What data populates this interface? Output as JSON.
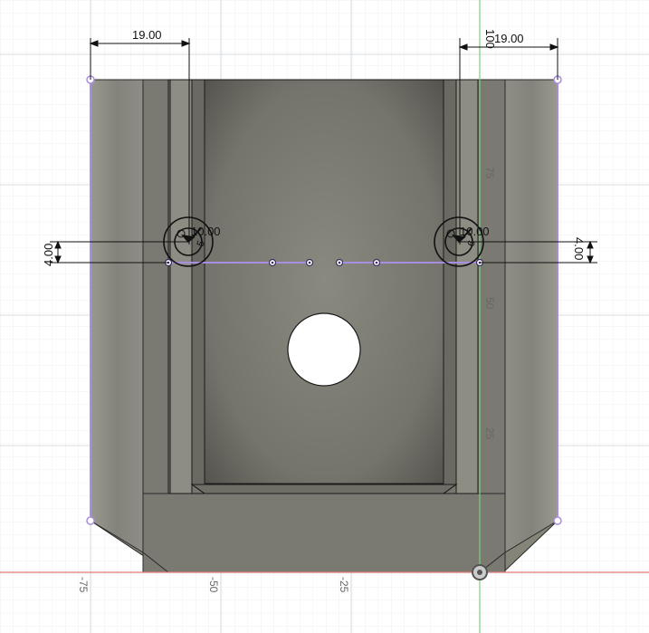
{
  "viewport": {
    "dimensions": {
      "top_left_width": "19.00",
      "top_right_width": "19.00",
      "left_offset": "4.00",
      "right_offset": "4.00",
      "left_circle_dia": "10.00",
      "right_circle_dia": "10.00",
      "left_circle_small": "5",
      "right_circle_small": "6",
      "vertical_100": "100"
    },
    "y_axis_ticks": [
      "75",
      "50",
      "25"
    ],
    "x_axis_ticks": [
      "-75",
      "-50",
      "-25"
    ],
    "colors": {
      "background": "#ffffff",
      "grid_minor": "#eef0f2",
      "grid_major": "#d9dde1",
      "x_axis": "#e07a7a",
      "y_axis": "#7ccf7c",
      "sketch_profile": "#a98de0",
      "body_outer": "#8c8b83",
      "body_inner": "#6e6e68",
      "outline": "#1a1a1a"
    }
  }
}
